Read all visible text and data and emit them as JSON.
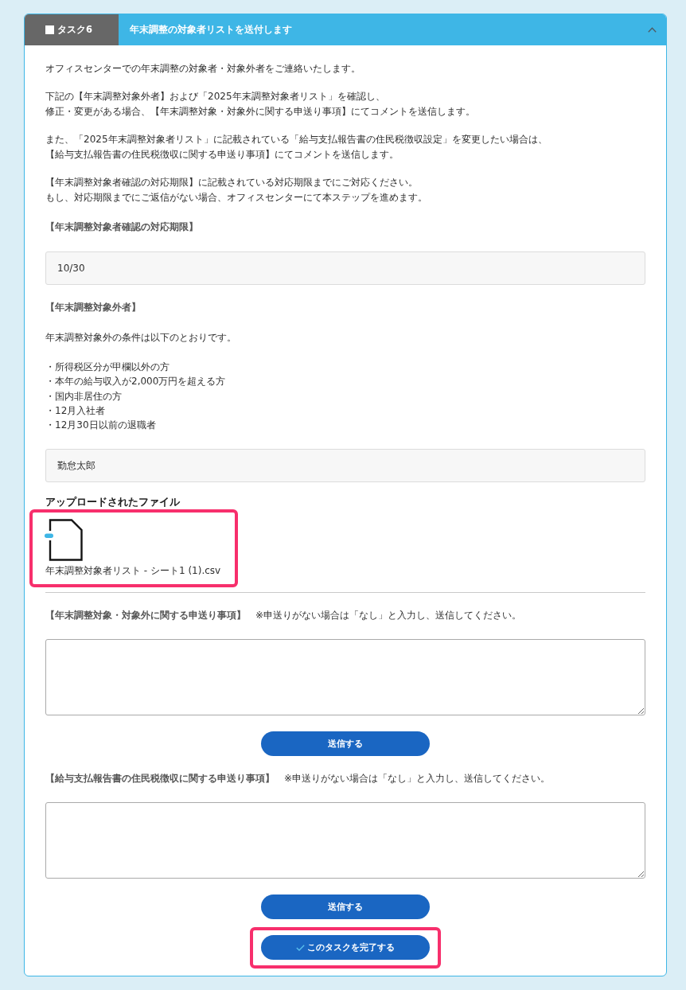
{
  "task": {
    "number_label": "タスク6",
    "done": false,
    "title": "年末調整の対象者リストを送付します",
    "expanded": true
  },
  "intro": [
    [
      "オフィスセンターでの年末調整の対象者・対象外者をご連絡いたします。"
    ],
    [
      "下記の【年末調整対象外者】および「2025年末調整対象者リスト」を確認し、",
      "修正・変更がある場合、【年末調整対象・対象外に関する申送り事項】にてコメントを送信します。"
    ],
    [
      "また、「2025年末調整対象者リスト」に記載されている「給与支払報告書の住民税徴収設定」を変更したい場合は、",
      "【給与支払報告書の住民税徴収に関する申送り事項】にてコメントを送信します。"
    ],
    [
      "【年末調整対象者確認の対応期限】に記載されている対応期限までにご対応ください。",
      "もし、対応期限までにご返信がない場合、オフィスセンターにて本ステップを進めます。"
    ]
  ],
  "deadline": {
    "heading": "【年末調整対象者確認の対応期限】",
    "value": "10/30"
  },
  "excluded": {
    "heading": "【年末調整対象外者】",
    "description": "年末調整対象外の条件は以下のとおりです。",
    "conditions": [
      "・所得税区分が甲欄以外の方",
      "・本年の給与収入が2,000万円を超える方",
      "・国内非居住の方",
      "・12月入社者",
      "・12月30日以前の退職者"
    ],
    "value": "勤怠太郎"
  },
  "uploaded": {
    "heading": "アップロードされたファイル",
    "files": [
      {
        "name": "年末調整対象者リスト - シート1 (1).csv",
        "highlighted": true
      }
    ]
  },
  "comment_forms": [
    {
      "label": "【年末調整対象・対象外に関する申送り事項】",
      "note": "※申送りがない場合は「なし」と入力し、送信してください。",
      "submit": "送信する"
    },
    {
      "label": "【給与支払報告書の住民税徴収に関する申送り事項】",
      "note": "※申送りがない場合は「なし」と入力し、送信してください。",
      "submit": "送信する"
    }
  ],
  "complete_button": {
    "label": "このタスクを完了する",
    "highlighted": true
  }
}
